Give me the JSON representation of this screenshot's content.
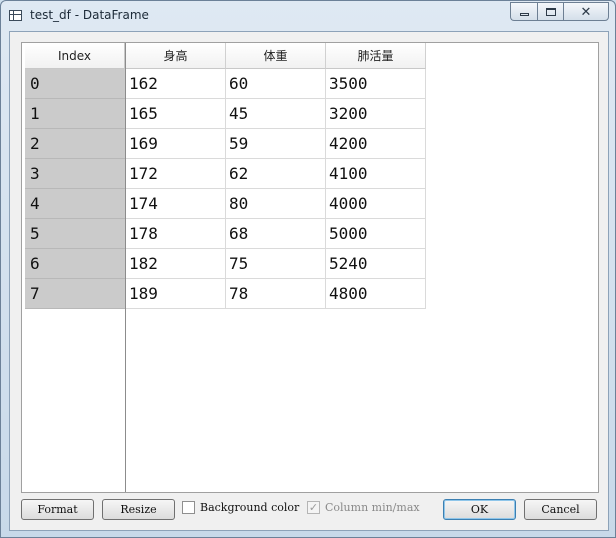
{
  "window": {
    "title": "test_df - DataFrame",
    "minimize_glyph": "",
    "close_glyph": "✕"
  },
  "table": {
    "index_header": "Index",
    "columns": [
      "身高",
      "体重",
      "肺活量"
    ],
    "index": [
      "0",
      "1",
      "2",
      "3",
      "4",
      "5",
      "6",
      "7"
    ],
    "rows": [
      [
        "162",
        "60",
        "3500"
      ],
      [
        "165",
        "45",
        "3200"
      ],
      [
        "169",
        "59",
        "4200"
      ],
      [
        "172",
        "62",
        "4100"
      ],
      [
        "174",
        "80",
        "4000"
      ],
      [
        "178",
        "68",
        "5000"
      ],
      [
        "182",
        "75",
        "5240"
      ],
      [
        "189",
        "78",
        "4800"
      ]
    ]
  },
  "toolbar": {
    "format_label": "Format",
    "resize_label": "Resize",
    "background_color_label": "Background color",
    "background_color_checked": false,
    "column_minmax_label": "Column min/max",
    "column_minmax_checked": true,
    "ok_label": "OK",
    "cancel_label": "Cancel"
  },
  "colors": {
    "index_background": "#cbcbcb",
    "ok_border": "#3c7fb1"
  }
}
